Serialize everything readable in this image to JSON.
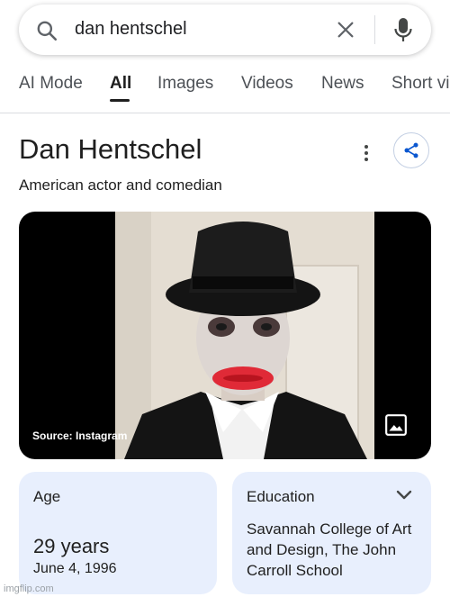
{
  "search": {
    "query": "dan hentschel"
  },
  "tabs": [
    {
      "label": "AI Mode"
    },
    {
      "label": "All"
    },
    {
      "label": "Images"
    },
    {
      "label": "Videos"
    },
    {
      "label": "News"
    },
    {
      "label": "Short vi"
    }
  ],
  "entity": {
    "title": "Dan Hentschel",
    "subtitle": "American actor and comedian",
    "image_source": "Source: Instagram"
  },
  "facts": {
    "age": {
      "label": "Age",
      "value": "29 years",
      "date": "June 4, 1996"
    },
    "education": {
      "label": "Education",
      "value": "Savannah College of Art and Design, The John Carroll School"
    }
  },
  "watermark": "imgflip.com",
  "colors": {
    "card_bg": "#e8effd",
    "share_icon": "#0b57d0",
    "divider": "#dadce0"
  },
  "icons": [
    "search-icon",
    "close-icon",
    "mic-icon",
    "more-vert-icon",
    "share-icon",
    "image-icon",
    "chevron-down-icon"
  ]
}
